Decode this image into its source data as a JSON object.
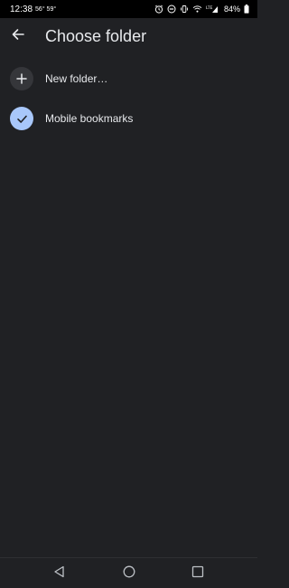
{
  "status_bar": {
    "time": "12:38",
    "temps": "56° 59°",
    "battery_percent": "84%",
    "icons": [
      "alarm-icon",
      "do-not-disturb-icon",
      "vibrate-icon",
      "wifi-icon",
      "signal-icon",
      "battery-icon"
    ]
  },
  "header": {
    "back_icon": "arrow-back-icon",
    "title": "Choose folder"
  },
  "folders": [
    {
      "label": "New folder…",
      "icon": "plus-icon",
      "selected": false
    },
    {
      "label": "Mobile bookmarks",
      "icon": "check-icon",
      "selected": true
    }
  ],
  "nav": {
    "icons": [
      "back-triangle-icon",
      "home-circle-icon",
      "recents-square-icon"
    ]
  },
  "colors": {
    "background": "#202124",
    "text": "#e8eaed",
    "selected_accent": "#a8c7fa",
    "icon_circle": "#35363a"
  }
}
